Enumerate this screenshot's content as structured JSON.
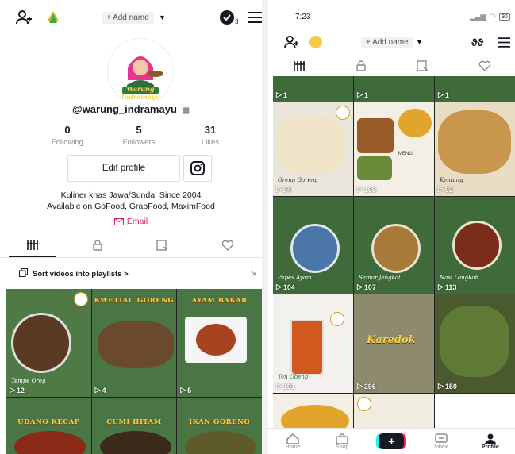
{
  "left": {
    "add_name": "+ Add name",
    "profile_badge_count": "3",
    "username": "@warung_indramayu",
    "avatar_text": "Warung Indramayu",
    "stats": [
      {
        "num": "0",
        "label": "Following"
      },
      {
        "num": "5",
        "label": "Followers"
      },
      {
        "num": "31",
        "label": "Likes"
      }
    ],
    "edit_profile": "Edit profile",
    "bio_line1": "Kuliner khas Jawa/Sunda, Since 2004",
    "bio_line2": "Available on GoFood, GrabFood, MaximFood",
    "email": "Email",
    "playlist": "Sort videos into playlists >",
    "videos": [
      {
        "views": "12",
        "title": "",
        "caption": "Tempe Oreg"
      },
      {
        "views": "4",
        "title": "KWETIAU GORENG",
        "caption": ""
      },
      {
        "views": "5",
        "title": "AYAM BAKAR",
        "caption": ""
      },
      {
        "views": "",
        "title": "UDANG KECAP",
        "caption": ""
      },
      {
        "views": "",
        "title": "CUMI HITAM",
        "caption": ""
      },
      {
        "views": "",
        "title": "IKAN GORENG",
        "caption": ""
      }
    ]
  },
  "right": {
    "time": "7:23",
    "battery": "90",
    "add_name": "+ Add name",
    "videos": [
      {
        "views": "1",
        "caption": ""
      },
      {
        "views": "1",
        "caption": ""
      },
      {
        "views": "1",
        "caption": ""
      },
      {
        "views": "94",
        "caption": "Oreng Goreng"
      },
      {
        "views": "108",
        "caption": "MENU"
      },
      {
        "views": "92",
        "caption": "Kentang"
      },
      {
        "views": "104",
        "caption": "Pepes Ayam"
      },
      {
        "views": "107",
        "caption": "Semur Jengkol"
      },
      {
        "views": "113",
        "caption": "Nasi Lengkoh"
      },
      {
        "views": "101",
        "caption": "Teh Obeng"
      },
      {
        "views": "296",
        "caption": "Karedok"
      },
      {
        "views": "150",
        "caption": ""
      },
      {
        "views": "",
        "caption": ""
      },
      {
        "views": "",
        "caption": ""
      },
      {
        "views": "",
        "caption": ""
      }
    ],
    "nav": [
      {
        "label": "Home",
        "icon": "home-icon"
      },
      {
        "label": "Shop",
        "icon": "shop-icon"
      },
      {
        "label": "",
        "icon": "plus-icon"
      },
      {
        "label": "Inbox",
        "icon": "inbox-icon"
      },
      {
        "label": "Profile",
        "icon": "profile-icon"
      }
    ]
  },
  "colors": {
    "accent_red": "#fe2c55",
    "accent_cyan": "#25f4ee",
    "card_green": "#3f6a3a",
    "title_gold": "#f4d04a"
  }
}
